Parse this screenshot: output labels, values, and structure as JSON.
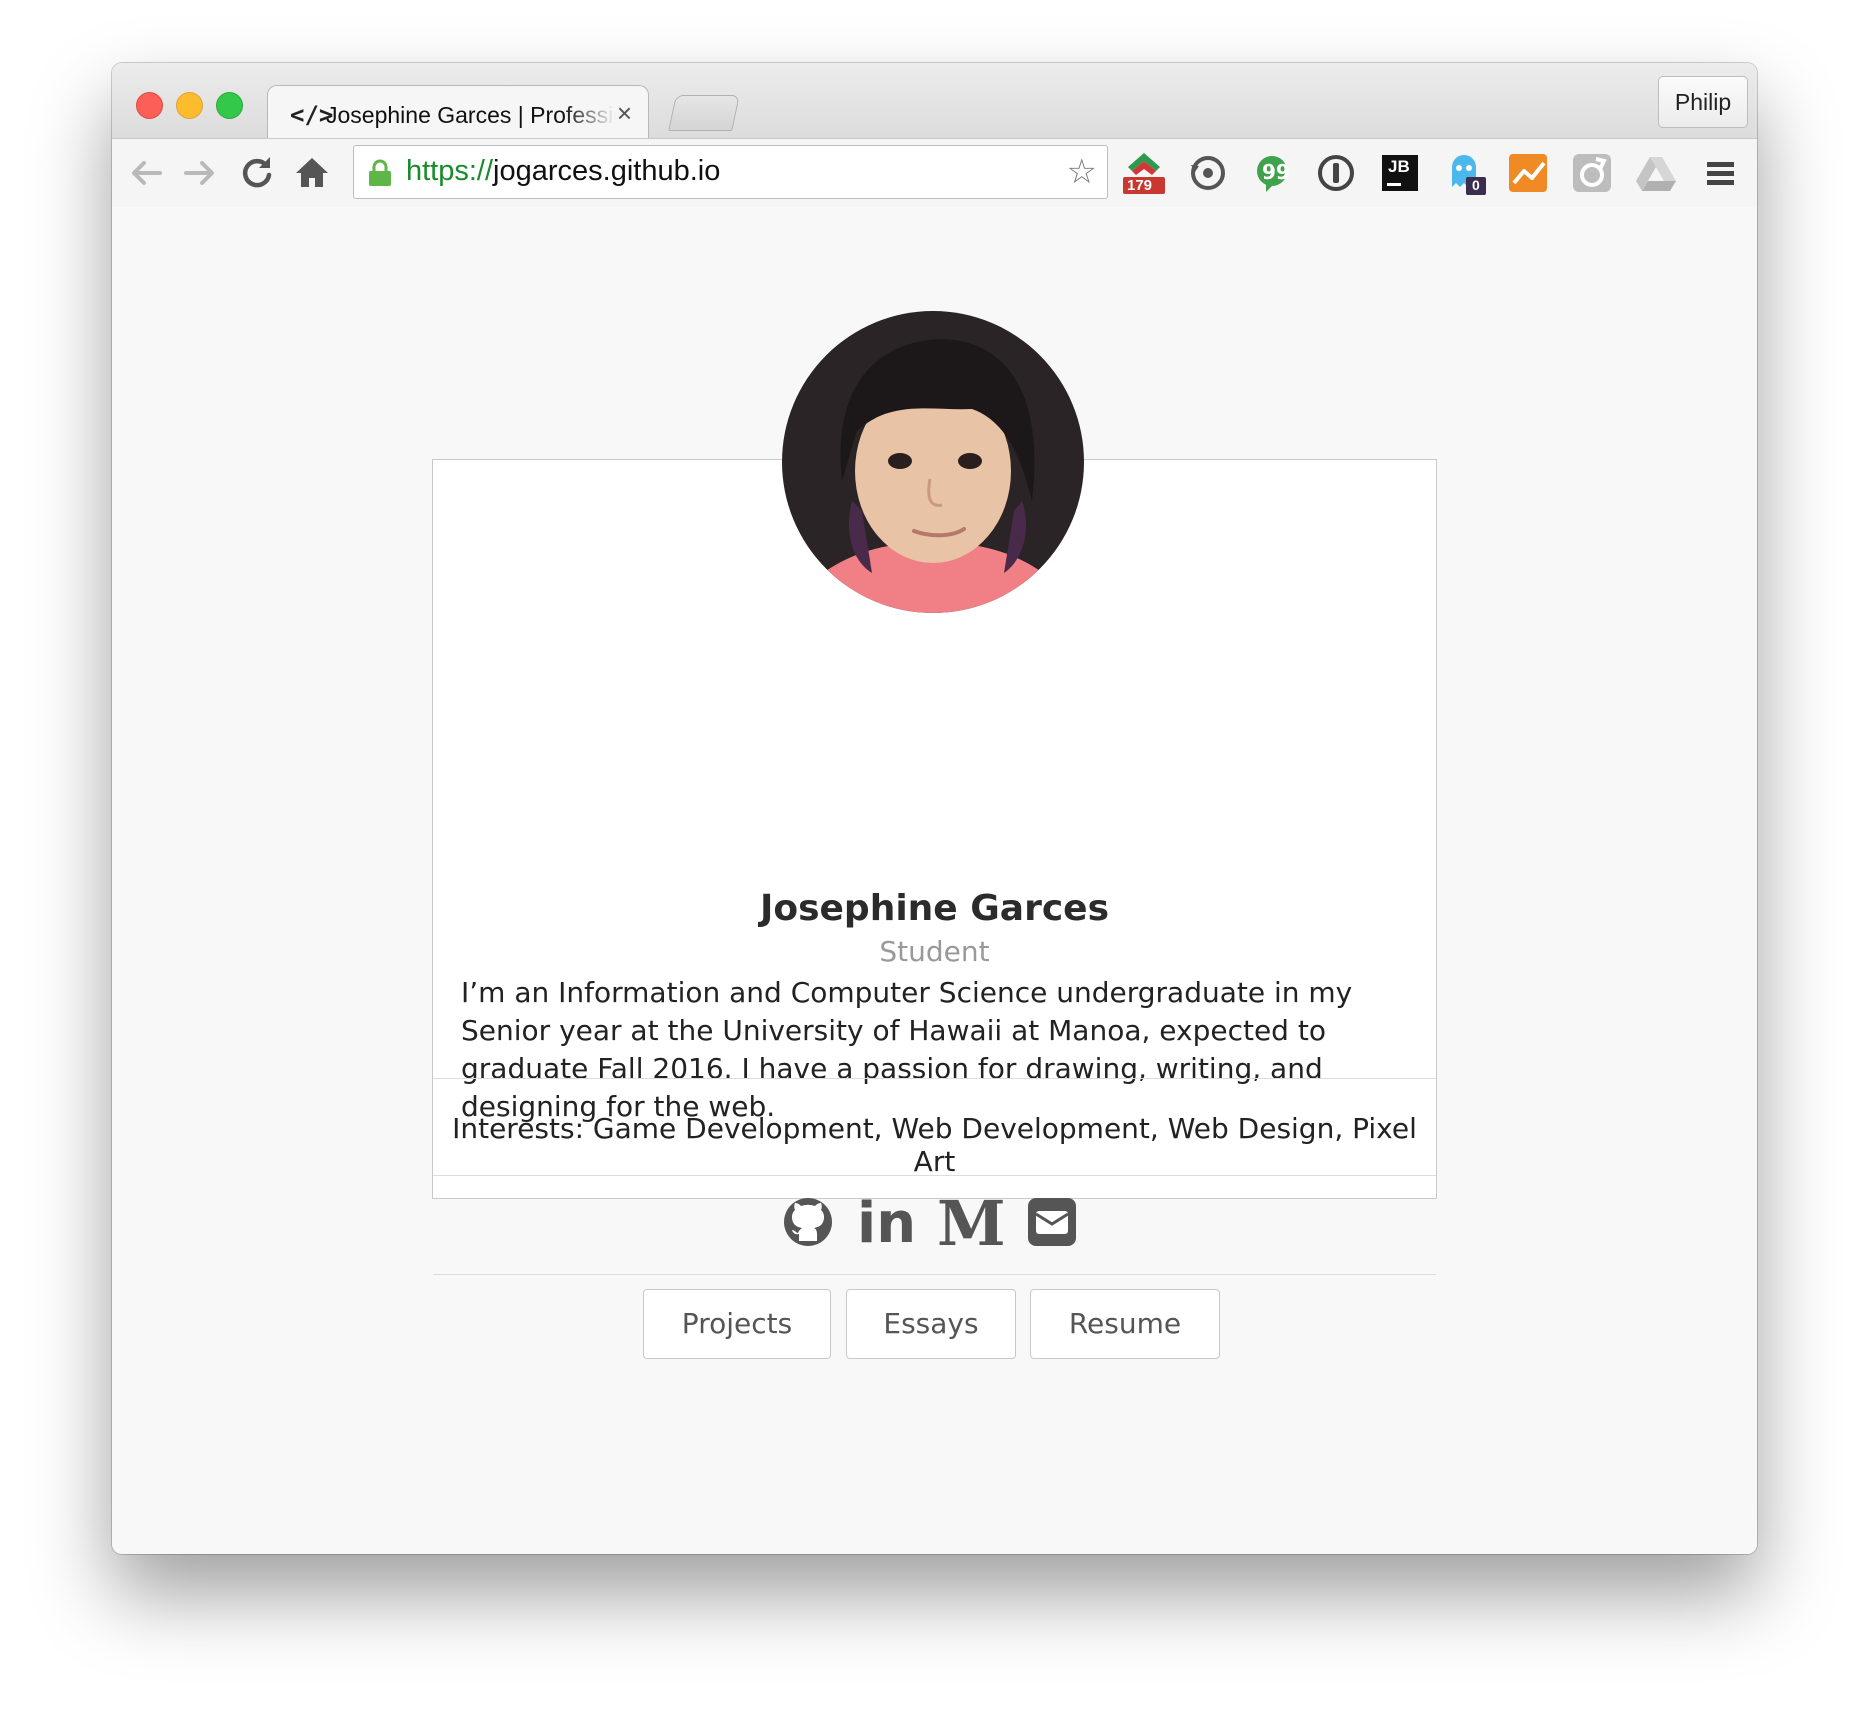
{
  "browser": {
    "tab": {
      "icon": "</>",
      "title": "Josephine Garces | Professional Portfolio",
      "close": "×"
    },
    "profile_name": "Philip",
    "url": {
      "scheme": "https://",
      "host": "jogarces.github.io"
    },
    "extensions": [
      {
        "name": "feedly-extension-icon",
        "badge": "179"
      },
      {
        "name": "sync-extension-icon"
      },
      {
        "name": "evernote-extension-icon"
      },
      {
        "name": "1password-extension-icon"
      },
      {
        "name": "jetbrains-extension-icon",
        "label": "JB"
      },
      {
        "name": "ghostery-extension-icon",
        "badge": "0"
      },
      {
        "name": "analytics-extension-icon"
      },
      {
        "name": "wrench-extension-icon"
      },
      {
        "name": "drive-extension-icon"
      }
    ]
  },
  "profile": {
    "name": "Josephine Garces",
    "role": "Student",
    "bio": "I’m an Information and Computer Science undergraduate in my Senior year at the University of Hawaii at Manoa, expected to graduate Fall 2016. I have a passion for drawing, writing, and designing for the web.",
    "interests": "Interests: Game Development, Web Development, Web Design, Pixel Art",
    "social": [
      "github-icon",
      "linkedin-icon",
      "medium-icon",
      "email-icon"
    ],
    "medium_glyph": "M",
    "linkedin_glyph": "in",
    "buttons": {
      "projects": "Projects",
      "essays": "Essays",
      "resume": "Resume"
    }
  },
  "colors": {
    "url_scheme": "#188c2a",
    "name_text": "#2b2b2b",
    "role_text": "#999999",
    "icon_gray": "#555555"
  }
}
